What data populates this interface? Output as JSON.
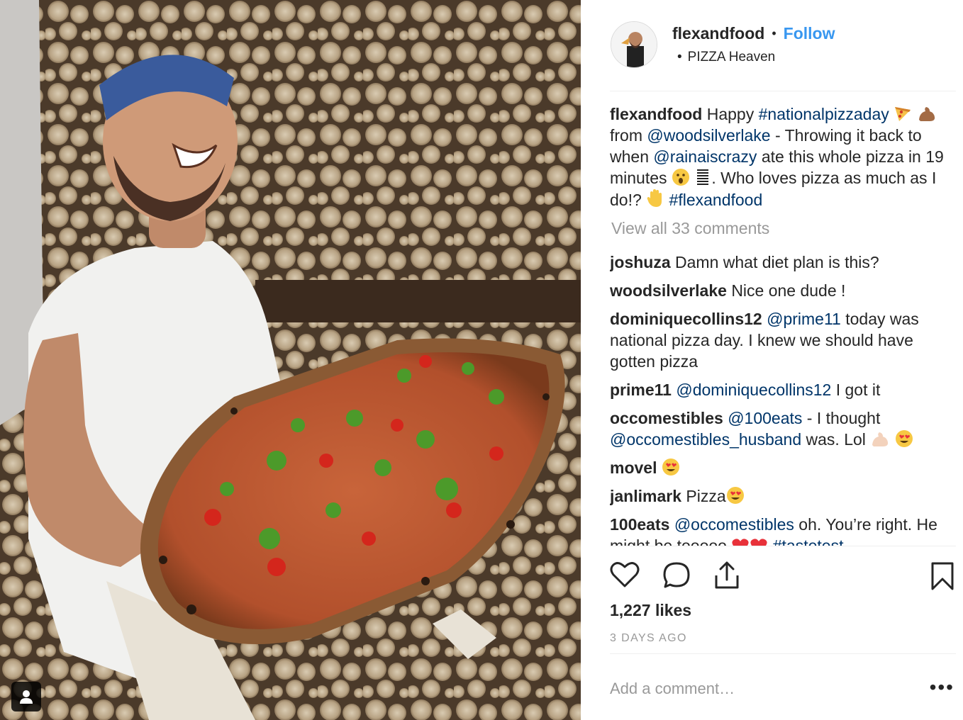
{
  "post": {
    "username": "flexandfood",
    "follow_label": "Follow",
    "location": "PIZZA Heaven",
    "caption": {
      "username": "flexandfood",
      "t1": "Happy ",
      "h1": "#nationalpizzaday",
      "t2": " from ",
      "m1": "@woodsilverlake",
      "t3": " - Throwing it back to when ",
      "m2": "@rainaiscrazy",
      "t4": " ate this whole pizza in 19 minutes ",
      "t5": ". Who loves pizza as much as I do!? ",
      "h2": "#flexandfood"
    },
    "view_all_comments": "View all 33 comments",
    "comments": [
      {
        "username": "joshuza",
        "text": "Damn what diet plan is this?"
      },
      {
        "username": "woodsilverlake",
        "text": "Nice one dude !"
      },
      {
        "username": "dominiquecollins12",
        "mention": "@prime11",
        "text": " today was national pizza day. I knew we should have gotten pizza"
      },
      {
        "username": "prime11",
        "mention": "@dominiquecollins12",
        "text": " I got it"
      },
      {
        "username": "occomestibles",
        "mention": "@100eats",
        "text": " - I thought ",
        "mention2": "@occomestibles_husband",
        "text2": " was. Lol "
      },
      {
        "username": "movel",
        "text": ""
      },
      {
        "username": "janlimark",
        "text": "Pizza"
      },
      {
        "username": "100eats",
        "mention": "@occomestibles",
        "text": " oh. You’re right. He might be tooooo ",
        "hashtag": "#tastetest"
      }
    ],
    "likes": "1,227 likes",
    "timestamp": "3 DAYS AGO",
    "add_comment_placeholder": "Add a comment…",
    "more_label": "•••"
  },
  "icons": [
    "heart-icon",
    "comment-icon",
    "share-icon",
    "bookmark-icon",
    "tag-person-icon"
  ],
  "colors": {
    "link": "#3897f0",
    "mention": "#003569",
    "muted": "#999999",
    "divider": "#efefef"
  }
}
